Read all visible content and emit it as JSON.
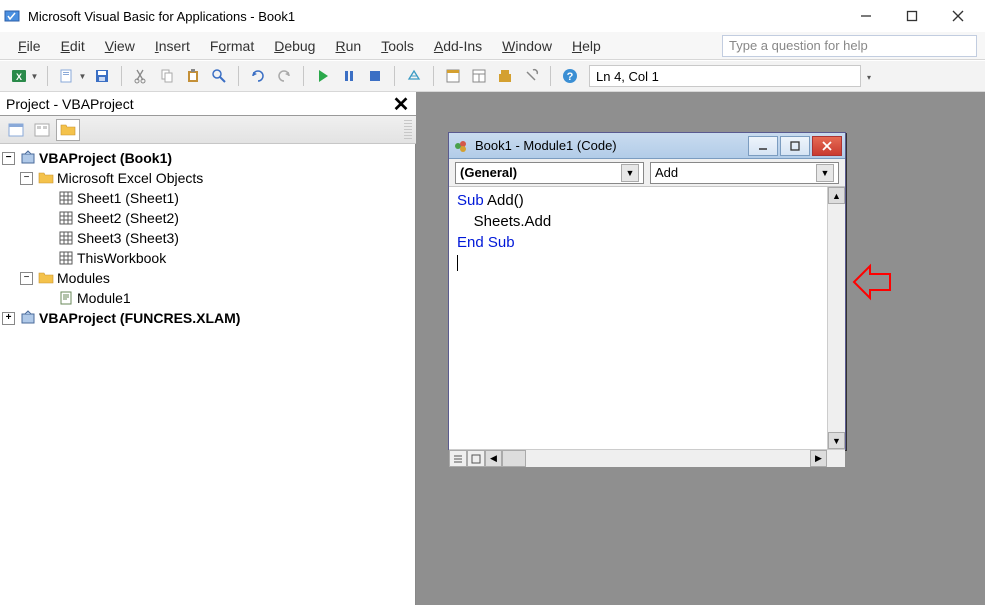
{
  "window": {
    "title": "Microsoft Visual Basic for Applications - Book1"
  },
  "menu": {
    "file": "File",
    "edit": "Edit",
    "view": "View",
    "insert": "Insert",
    "format": "Format",
    "debug": "Debug",
    "run": "Run",
    "tools": "Tools",
    "addins": "Add-Ins",
    "window": "Window",
    "help": "Help",
    "search_placeholder": "Type a question for help"
  },
  "toolbar": {
    "status": "Ln 4, Col 1"
  },
  "project_pane": {
    "title": "Project - VBAProject",
    "root1": "VBAProject (Book1)",
    "exobjs": "Microsoft Excel Objects",
    "sheet1": "Sheet1 (Sheet1)",
    "sheet2": "Sheet2 (Sheet2)",
    "sheet3": "Sheet3 (Sheet3)",
    "thiswb": "ThisWorkbook",
    "modules": "Modules",
    "module1": "Module1",
    "root2": "VBAProject (FUNCRES.XLAM)"
  },
  "code_window": {
    "title": "Book1 - Module1 (Code)",
    "combo_left": "(General)",
    "combo_right": "Add",
    "line1_kw": "Sub ",
    "line1_rest": "Add()",
    "line2": "    Sheets.Add",
    "line3": "End Sub"
  }
}
